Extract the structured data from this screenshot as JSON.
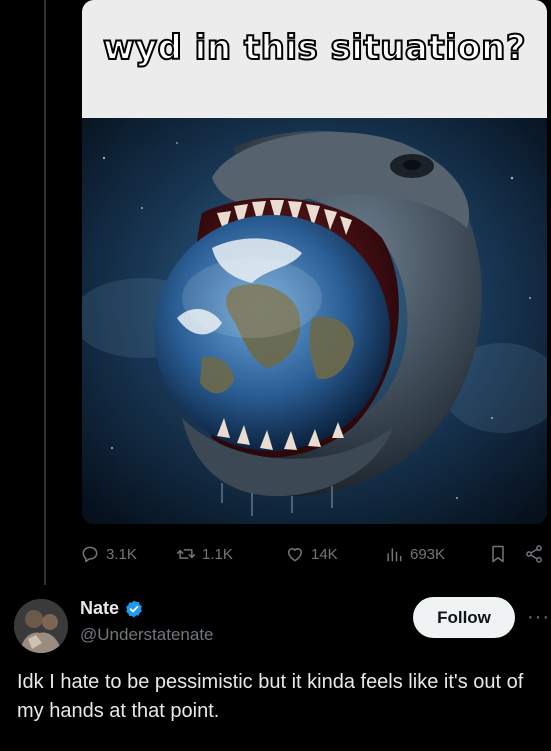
{
  "post": {
    "image_caption": "wyd in this situation?",
    "stats": {
      "replies": "3.1K",
      "reposts": "1.1K",
      "likes": "14K",
      "views": "693K"
    }
  },
  "reply": {
    "author_name": "Nate",
    "author_handle": "@Understatenate",
    "follow_label": "Follow",
    "more_label": "···",
    "text": "Idk I hate to be pessimistic but it kinda feels like it's out of my hands at that point."
  },
  "icons": {
    "reply": "speech-bubble-icon",
    "repost": "repost-arrows-icon",
    "like": "heart-icon",
    "views": "bar-chart-icon",
    "bookmark": "bookmark-icon",
    "share": "share-icon",
    "verified": "verified-badge-icon"
  },
  "colors": {
    "background": "#000000",
    "muted": "#71767b",
    "text": "#e7e9ea",
    "verified": "#1d9bf0",
    "follow_bg": "#eff3f4"
  }
}
